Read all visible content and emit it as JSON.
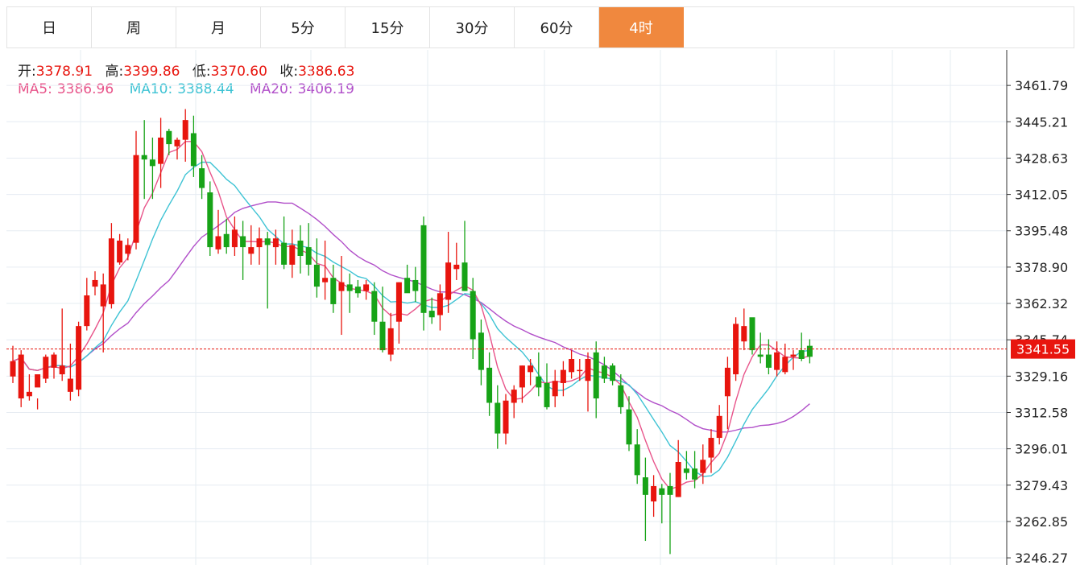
{
  "tabs": [
    {
      "label": "日",
      "active": false
    },
    {
      "label": "周",
      "active": false
    },
    {
      "label": "月",
      "active": false
    },
    {
      "label": "5分",
      "active": false
    },
    {
      "label": "15分",
      "active": false
    },
    {
      "label": "30分",
      "active": false
    },
    {
      "label": "60分",
      "active": false
    },
    {
      "label": "4时",
      "active": true
    }
  ],
  "ohlc": {
    "open_label": "开:",
    "open": "3378.91",
    "high_label": "高:",
    "high": "3399.86",
    "low_label": "低:",
    "low": "3370.60",
    "close_label": "收:",
    "close": "3386.63"
  },
  "ma": {
    "ma5_label": "MA5:",
    "ma5": "3386.96",
    "ma10_label": "MA10:",
    "ma10": "3388.44",
    "ma20_label": "MA20:",
    "ma20": "3406.19"
  },
  "last_price": "3341.55",
  "colors": {
    "up": "#e8150e",
    "down": "#17a317",
    "ma5": "#e8548a",
    "ma10": "#3ec3d4",
    "ma20": "#b14fc9",
    "accent": "#f0883e",
    "grid": "#e6ecf2",
    "price_line": "#e8150e",
    "label_red": "#e8150e"
  },
  "chart_data": {
    "type": "candlestick",
    "y_ticks": [
      "3461.79",
      "3445.21",
      "3428.63",
      "3412.05",
      "3395.48",
      "3378.90",
      "3362.32",
      "3345.74",
      "3329.16",
      "3312.58",
      "3296.01",
      "3279.43",
      "3262.85",
      "3246.27"
    ],
    "ylim": [
      3243,
      3478
    ],
    "candles": [
      [
        3329,
        3343,
        3326,
        3336
      ],
      [
        3319,
        3341,
        3315,
        3339
      ],
      [
        3320,
        3330,
        3318,
        3322
      ],
      [
        3324,
        3319,
        3314,
        3330
      ],
      [
        3328,
        3339,
        3326,
        3338
      ],
      [
        3333,
        3340,
        3328,
        3339
      ],
      [
        3330,
        3360,
        3327,
        3334
      ],
      [
        3322,
        3344,
        3318,
        3328
      ],
      [
        3323,
        3354,
        3320,
        3352
      ],
      [
        3352,
        3374,
        3350,
        3366
      ],
      [
        3370,
        3377,
        3366,
        3373
      ],
      [
        3361,
        3376,
        3340,
        3371
      ],
      [
        3362,
        3399,
        3360,
        3392
      ],
      [
        3381,
        3394,
        3380,
        3391
      ],
      [
        3385,
        3392,
        3382,
        3389
      ],
      [
        3390,
        3441,
        3387,
        3430
      ],
      [
        3430,
        3446,
        3410,
        3428
      ],
      [
        3428,
        3438,
        3410,
        3425
      ],
      [
        3426,
        3447,
        3415,
        3438
      ],
      [
        3441,
        3442,
        3430,
        3435
      ],
      [
        3434,
        3438,
        3428,
        3437
      ],
      [
        3437,
        3451,
        3427,
        3446
      ],
      [
        3440,
        3448,
        3420,
        3425
      ],
      [
        3424,
        3430,
        3410,
        3415
      ],
      [
        3413,
        3418,
        3384,
        3388
      ],
      [
        3387,
        3405,
        3385,
        3393
      ],
      [
        3394,
        3401,
        3385,
        3388
      ],
      [
        3388,
        3402,
        3384,
        3396
      ],
      [
        3393,
        3400,
        3373,
        3388
      ],
      [
        3385,
        3398,
        3380,
        3388
      ],
      [
        3388,
        3397,
        3380,
        3392
      ],
      [
        3392,
        3395,
        3360,
        3389
      ],
      [
        3388,
        3396,
        3380,
        3392
      ],
      [
        3390,
        3402,
        3378,
        3380
      ],
      [
        3380,
        3396,
        3374,
        3389
      ],
      [
        3391,
        3398,
        3376,
        3384
      ],
      [
        3388,
        3399,
        3375,
        3380
      ],
      [
        3380,
        3392,
        3365,
        3370
      ],
      [
        3372,
        3391,
        3364,
        3374
      ],
      [
        3374,
        3380,
        3358,
        3362
      ],
      [
        3368,
        3384,
        3348,
        3372
      ],
      [
        3371,
        3376,
        3358,
        3368
      ],
      [
        3370,
        3373,
        3365,
        3367
      ],
      [
        3368,
        3373,
        3364,
        3371
      ],
      [
        3368,
        3372,
        3348,
        3354
      ],
      [
        3354,
        3370,
        3340,
        3341
      ],
      [
        3339,
        3358,
        3336,
        3351
      ],
      [
        3354,
        3372,
        3344,
        3372
      ],
      [
        3374,
        3380,
        3370,
        3367
      ],
      [
        3373,
        3379,
        3363,
        3368
      ],
      [
        3398,
        3402,
        3350,
        3358
      ],
      [
        3359,
        3365,
        3353,
        3356
      ],
      [
        3357,
        3371,
        3350,
        3367
      ],
      [
        3364,
        3395,
        3358,
        3381
      ],
      [
        3378,
        3390,
        3373,
        3380
      ],
      [
        3381,
        3400,
        3368,
        3368
      ],
      [
        3368,
        3374,
        3337,
        3346
      ],
      [
        3349,
        3355,
        3325,
        3332
      ],
      [
        3333,
        3340,
        3311,
        3317
      ],
      [
        3317,
        3325,
        3296,
        3303
      ],
      [
        3303,
        3321,
        3298,
        3318
      ],
      [
        3317,
        3325,
        3310,
        3323
      ],
      [
        3324,
        3334,
        3317,
        3334
      ],
      [
        3331,
        3337,
        3325,
        3334
      ],
      [
        3329,
        3340,
        3320,
        3324
      ],
      [
        3326,
        3335,
        3314,
        3315
      ],
      [
        3320,
        3332,
        3315,
        3327
      ],
      [
        3326,
        3336,
        3320,
        3332
      ],
      [
        3331,
        3341,
        3328,
        3337
      ],
      [
        3332,
        3337,
        3327,
        3332
      ],
      [
        3327,
        3340,
        3313,
        3337
      ],
      [
        3340,
        3345,
        3310,
        3319
      ],
      [
        3334,
        3338,
        3326,
        3328
      ],
      [
        3334,
        3335,
        3325,
        3327
      ],
      [
        3325,
        3330,
        3312,
        3315
      ],
      [
        3314,
        3320,
        3295,
        3298
      ],
      [
        3298,
        3305,
        3280,
        3284
      ],
      [
        3283,
        3292,
        3254,
        3275
      ],
      [
        3272,
        3284,
        3265,
        3279
      ],
      [
        3278,
        3280,
        3262,
        3275
      ],
      [
        3279,
        3285,
        3248,
        3275
      ],
      [
        3274,
        3300,
        3274,
        3290
      ],
      [
        3287,
        3295,
        3282,
        3285
      ],
      [
        3287,
        3295,
        3278,
        3282
      ],
      [
        3285,
        3298,
        3280,
        3291
      ],
      [
        3292,
        3305,
        3285,
        3301
      ],
      [
        3301,
        3316,
        3298,
        3311
      ],
      [
        3320,
        3338,
        3305,
        3333
      ],
      [
        3330,
        3356,
        3327,
        3353
      ],
      [
        3345,
        3360,
        3341,
        3352
      ],
      [
        3356,
        3355,
        3339,
        3341
      ],
      [
        3339,
        3349,
        3335,
        3338
      ],
      [
        3339,
        3346,
        3330,
        3333
      ],
      [
        3332,
        3345,
        3329,
        3340
      ],
      [
        3331,
        3344,
        3330,
        3338
      ],
      [
        3338,
        3341,
        3332,
        3339
      ],
      [
        3341,
        3349,
        3336,
        3337
      ],
      [
        3343,
        3346,
        3335,
        3338
      ]
    ]
  }
}
